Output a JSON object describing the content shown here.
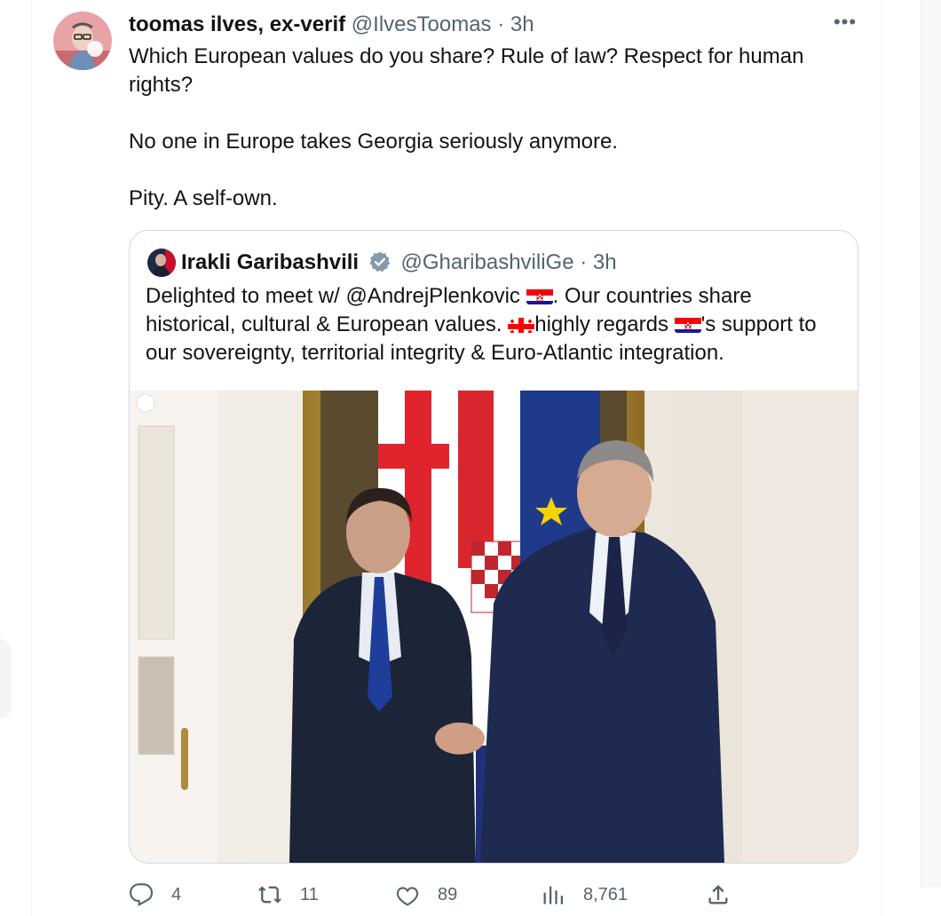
{
  "tweet": {
    "author_name": "toomas ilves, ex-verif",
    "author_handle": "@IlvesToomas",
    "separator": "·",
    "time": "3h",
    "more_label": "•••",
    "text_paragraphs": [
      "Which European values do you share? Rule of law? Respect for human rights?",
      "No one in Europe takes Georgia seriously anymore.",
      "Pity. A self-own."
    ]
  },
  "quoted": {
    "author_name": "Irakli Garibashvili",
    "author_handle": "@GharibashviliGe",
    "separator": "·",
    "time": "3h",
    "text": {
      "p1": "Delighted to meet w/ @AndrejPlenkovic ",
      "p2": ". Our countries share historical, cultural & European values. ",
      "p3": "highly regards ",
      "p4": "'s support to our sovereignty, territorial integrity & Euro-Atlantic integration."
    }
  },
  "actions": {
    "replies": "4",
    "reposts": "11",
    "likes": "89",
    "views": "8,761"
  },
  "colors": {
    "text_primary": "#0f1419",
    "text_secondary": "#536471",
    "border": "#cfd9de",
    "verified_badge": "#829aab"
  },
  "icons": [
    "reply-icon",
    "repost-icon",
    "like-icon",
    "views-icon",
    "share-icon",
    "verified-icon",
    "more-icon"
  ]
}
